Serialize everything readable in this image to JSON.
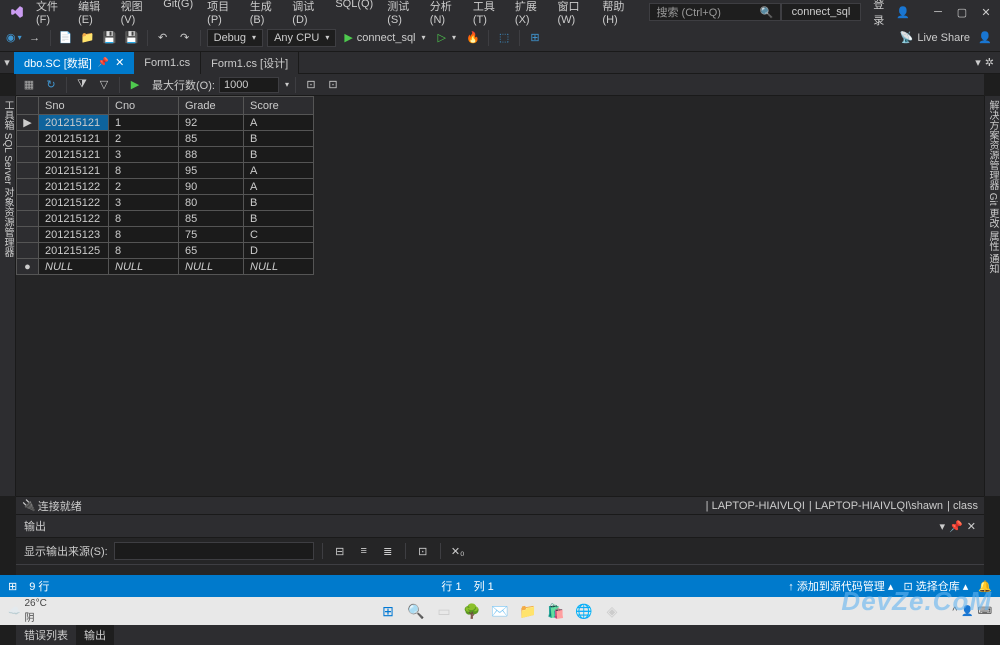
{
  "menu": [
    "文件(F)",
    "编辑(E)",
    "视图(V)",
    "Git(G)",
    "项目(P)",
    "生成(B)",
    "调试(D)",
    "SQL(Q)",
    "测试(S)",
    "分析(N)",
    "工具(T)",
    "扩展(X)",
    "窗口(W)",
    "帮助(H)"
  ],
  "search_placeholder": "搜索 (Ctrl+Q)",
  "project_name": "connect_sql",
  "login": "登录",
  "toolbar": {
    "config": "Debug",
    "platform": "Any CPU",
    "run_target": "connect_sql",
    "live_share": "Live Share"
  },
  "tabs": [
    {
      "label": "dbo.SC [数据]",
      "active": true,
      "pinned": true
    },
    {
      "label": "Form1.cs",
      "active": false
    },
    {
      "label": "Form1.cs [设计]",
      "active": false
    }
  ],
  "data_toolbar": {
    "max_rows_label": "最大行数(O):",
    "max_rows_value": "1000"
  },
  "grid": {
    "columns": [
      "Sno",
      "Cno",
      "Grade",
      "Score"
    ],
    "rows": [
      {
        "Sno": "201215121",
        "Cno": "1",
        "Grade": "92",
        "Score": "A",
        "selected": true
      },
      {
        "Sno": "201215121",
        "Cno": "2",
        "Grade": "85",
        "Score": "B"
      },
      {
        "Sno": "201215121",
        "Cno": "3",
        "Grade": "88",
        "Score": "B"
      },
      {
        "Sno": "201215121",
        "Cno": "8",
        "Grade": "95",
        "Score": "A"
      },
      {
        "Sno": "201215122",
        "Cno": "2",
        "Grade": "90",
        "Score": "A"
      },
      {
        "Sno": "201215122",
        "Cno": "3",
        "Grade": "80",
        "Score": "B"
      },
      {
        "Sno": "201215122",
        "Cno": "8",
        "Grade": "85",
        "Score": "B"
      },
      {
        "Sno": "201215123",
        "Cno": "8",
        "Grade": "75",
        "Score": "C"
      },
      {
        "Sno": "201215125",
        "Cno": "8",
        "Grade": "65",
        "Score": "D"
      },
      {
        "Sno": "NULL",
        "Cno": "NULL",
        "Grade": "NULL",
        "Score": "NULL",
        "null_row": true
      }
    ]
  },
  "connection": {
    "status": "连接就绪",
    "server": "LAPTOP-HIAIVLQI",
    "user": "LAPTOP-HIAIVLQI\\shawn",
    "db": "class"
  },
  "output": {
    "title": "输出",
    "source_label": "显示输出来源(S):"
  },
  "bottom_tabs": {
    "errors": "错误列表",
    "output": "输出"
  },
  "status": {
    "rows": "9 行",
    "line": "行 1",
    "col": "列 1",
    "add_source": "添加到源代码管理",
    "repo": "选择仓库"
  },
  "left_panels": [
    "工具箱",
    "SQL Server 对象资源管理器"
  ],
  "right_panels": [
    "解决方案资源管理器",
    "Git 更改",
    "属性",
    "通知"
  ],
  "weather": {
    "temp": "26°C",
    "desc": "阴"
  },
  "watermark": "DevZe.CoM"
}
